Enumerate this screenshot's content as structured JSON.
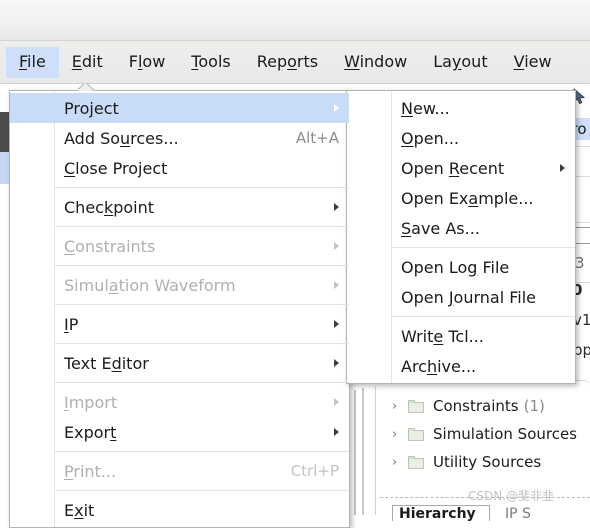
{
  "menubar": {
    "items": [
      {
        "pre": "",
        "mn": "F",
        "post": "ile",
        "name": "menubar-item-file",
        "open": true
      },
      {
        "pre": "",
        "mn": "E",
        "post": "dit",
        "name": "menubar-item-edit",
        "open": false
      },
      {
        "pre": "F",
        "mn": "l",
        "post": "ow",
        "name": "menubar-item-flow",
        "open": false
      },
      {
        "pre": "",
        "mn": "T",
        "post": "ools",
        "name": "menubar-item-tools",
        "open": false
      },
      {
        "pre": "Rep",
        "mn": "o",
        "post": "rts",
        "name": "menubar-item-reports",
        "open": false
      },
      {
        "pre": "",
        "mn": "W",
        "post": "indow",
        "name": "menubar-item-window",
        "open": false
      },
      {
        "pre": "La",
        "mn": "y",
        "post": "out",
        "name": "menubar-item-layout",
        "open": false
      },
      {
        "pre": "",
        "mn": "V",
        "post": "iew",
        "name": "menubar-item-view",
        "open": false
      }
    ]
  },
  "file_menu": {
    "items": [
      {
        "type": "item",
        "pre": "Pro",
        "mn": "j",
        "post": "ect",
        "accel": "",
        "arrow": true,
        "disabled": false,
        "highlight": true,
        "name": "menu-item-project"
      },
      {
        "type": "item",
        "pre": "Add So",
        "mn": "u",
        "post": "rces...",
        "accel": "Alt+A",
        "arrow": false,
        "disabled": false,
        "highlight": false,
        "name": "menu-item-add-sources"
      },
      {
        "type": "item",
        "pre": "",
        "mn": "C",
        "post": "lose Project",
        "accel": "",
        "arrow": false,
        "disabled": false,
        "highlight": false,
        "name": "menu-item-close-project"
      },
      {
        "type": "sep"
      },
      {
        "type": "item",
        "pre": "Chec",
        "mn": "k",
        "post": "point",
        "accel": "",
        "arrow": true,
        "disabled": false,
        "highlight": false,
        "name": "menu-item-checkpoint"
      },
      {
        "type": "sep"
      },
      {
        "type": "item",
        "pre": "",
        "mn": "C",
        "post": "onstraints",
        "accel": "",
        "arrow": true,
        "disabled": true,
        "highlight": false,
        "name": "menu-item-constraints"
      },
      {
        "type": "sep"
      },
      {
        "type": "item",
        "pre": "Simul",
        "mn": "a",
        "post": "tion Waveform",
        "accel": "",
        "arrow": true,
        "disabled": true,
        "highlight": false,
        "name": "menu-item-simulation-waveform"
      },
      {
        "type": "sep"
      },
      {
        "type": "item",
        "pre": "",
        "mn": "I",
        "post": "P",
        "accel": "",
        "arrow": true,
        "disabled": false,
        "highlight": false,
        "name": "menu-item-ip"
      },
      {
        "type": "sep"
      },
      {
        "type": "item",
        "pre": "Text E",
        "mn": "d",
        "post": "itor",
        "accel": "",
        "arrow": true,
        "disabled": false,
        "highlight": false,
        "name": "menu-item-text-editor"
      },
      {
        "type": "sep"
      },
      {
        "type": "item",
        "pre": "",
        "mn": "I",
        "post": "mport",
        "accel": "",
        "arrow": true,
        "disabled": true,
        "highlight": false,
        "name": "menu-item-import"
      },
      {
        "type": "item",
        "pre": "Expor",
        "mn": "t",
        "post": "",
        "accel": "",
        "arrow": true,
        "disabled": false,
        "highlight": false,
        "name": "menu-item-export"
      },
      {
        "type": "sep"
      },
      {
        "type": "item",
        "pre": "",
        "mn": "P",
        "post": "rint...",
        "accel": "Ctrl+P",
        "arrow": false,
        "disabled": true,
        "highlight": false,
        "name": "menu-item-print"
      },
      {
        "type": "sep"
      },
      {
        "type": "item",
        "pre": "E",
        "mn": "x",
        "post": "it",
        "accel": "",
        "arrow": false,
        "disabled": false,
        "highlight": false,
        "name": "menu-item-exit"
      }
    ]
  },
  "project_submenu": {
    "items": [
      {
        "type": "item",
        "pre": "",
        "mn": "N",
        "post": "ew...",
        "accel": "",
        "arrow": false,
        "disabled": false,
        "highlight": false,
        "name": "submenu-item-new"
      },
      {
        "type": "item",
        "pre": "",
        "mn": "O",
        "post": "pen...",
        "accel": "",
        "arrow": false,
        "disabled": false,
        "highlight": false,
        "name": "submenu-item-open"
      },
      {
        "type": "item",
        "pre": "Open ",
        "mn": "R",
        "post": "ecent",
        "accel": "",
        "arrow": true,
        "disabled": false,
        "highlight": false,
        "name": "submenu-item-open-recent"
      },
      {
        "type": "item",
        "pre": "Open Ex",
        "mn": "a",
        "post": "mple...",
        "accel": "",
        "arrow": false,
        "disabled": false,
        "highlight": false,
        "name": "submenu-item-open-example"
      },
      {
        "type": "item",
        "pre": "",
        "mn": "S",
        "post": "ave As...",
        "accel": "",
        "arrow": false,
        "disabled": false,
        "highlight": false,
        "name": "submenu-item-save-as"
      },
      {
        "type": "sep"
      },
      {
        "type": "item",
        "pre": "Open Lo",
        "mn": "g",
        "post": " File",
        "accel": "",
        "arrow": false,
        "disabled": false,
        "highlight": false,
        "name": "submenu-item-open-log-file"
      },
      {
        "type": "item",
        "pre": "Open ",
        "mn": "J",
        "post": "ournal File",
        "accel": "",
        "arrow": false,
        "disabled": false,
        "highlight": false,
        "name": "submenu-item-open-journal-file"
      },
      {
        "type": "sep"
      },
      {
        "type": "item",
        "pre": "Writ",
        "mn": "e",
        "post": " Tcl...",
        "accel": "",
        "arrow": false,
        "disabled": false,
        "highlight": false,
        "name": "submenu-item-write-tcl"
      },
      {
        "type": "item",
        "pre": "Arc",
        "mn": "h",
        "post": "ive...",
        "accel": "",
        "arrow": false,
        "disabled": false,
        "highlight": false,
        "name": "submenu-item-archive"
      }
    ]
  },
  "background": {
    "selected_row_text": "pro",
    "fragments": {
      "num": "3",
      "bold": "0",
      "v1": "v1",
      "p1": "pp"
    },
    "tree": [
      {
        "label": "Constraints",
        "count": "(1)",
        "name": "tree-item-constraints"
      },
      {
        "label": "Simulation Sources",
        "count": "",
        "name": "tree-item-simulation-sources"
      },
      {
        "label": "Utility Sources",
        "count": "",
        "name": "tree-item-utility-sources"
      }
    ],
    "watermark": "CSDN.@斐非韭",
    "bottom_tab": "Hierarchy",
    "bottom_tab2": "IP S"
  },
  "colors": {
    "menu_highlight": "#c9dcf7",
    "menubar_open": "#cfdffa",
    "menu_bg": "#ffffff",
    "disabled_text": "#b0b0b0"
  }
}
